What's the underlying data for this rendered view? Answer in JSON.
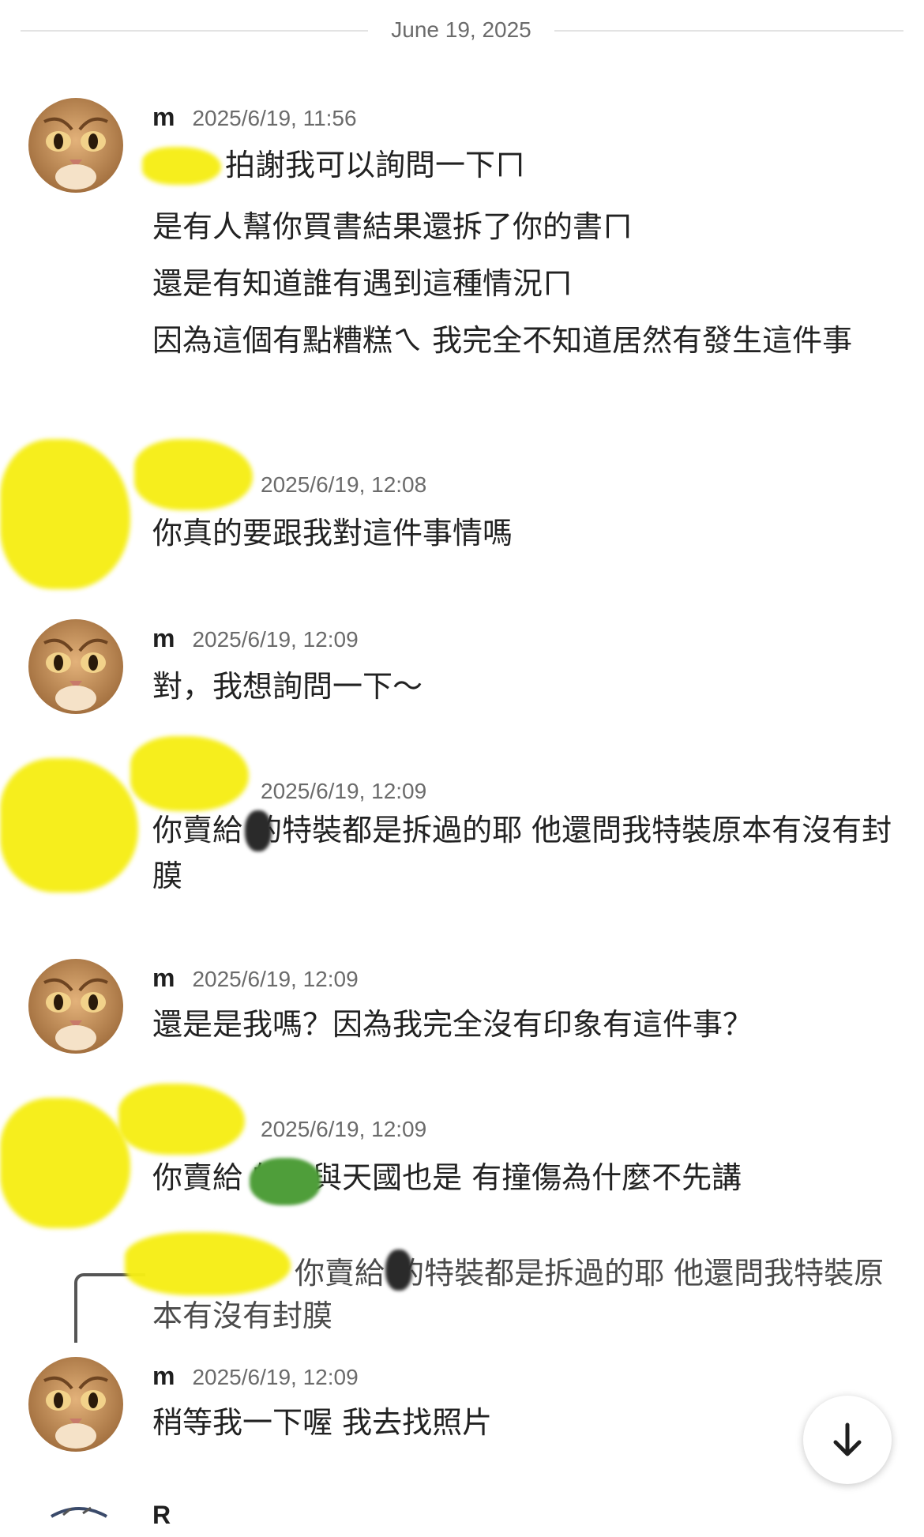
{
  "date_divider": "June 19, 2025",
  "messages": [
    {
      "sender": "m",
      "time": "2025/6/19, 11:56",
      "lines": [
        "拍謝我可以詢問一下ㄇ",
        "是有人幫你買書結果還拆了你的書ㄇ",
        "還是有知道誰有遇到這種情況ㄇ",
        "因為這個有點糟糕ㄟ 我完全不知道居然有發生這件事"
      ]
    },
    {
      "sender": "",
      "time": "2025/6/19, 12:08",
      "lines": [
        "你真的要跟我對這件事情嗎"
      ]
    },
    {
      "sender": "m",
      "time": "2025/6/19, 12:09",
      "lines": [
        "對，我想詢問一下～"
      ]
    },
    {
      "sender": "",
      "time": "2025/6/19, 12:09",
      "lines": [
        "你賣給 的特裝都是拆過的耶  他還問我特裝原本有沒有封膜"
      ]
    },
    {
      "sender": "m",
      "time": "2025/6/19, 12:09",
      "lines": [
        "還是是我嗎？因為我完全沒有印象有這件事？"
      ]
    },
    {
      "sender": "",
      "time": "2025/6/19, 12:09",
      "lines": [
        "你賣給       的鬼與天國也是  有撞傷為什麼不先講"
      ]
    },
    {
      "reply_quote": "你賣給 的特裝都是拆過的耶  他還問我特裝原本有沒有封膜",
      "sender": "m",
      "time": "2025/6/19, 12:09",
      "lines": [
        "稍等我一下喔 我去找照片"
      ]
    }
  ],
  "next_sender_partial": "R",
  "icons": {
    "scroll_down": "arrow-down-icon",
    "avatar": "cat-avatar"
  },
  "colors": {
    "redaction_yellow": "#f6ee16",
    "redaction_green": "#4f9e3a",
    "muted_text": "#6b6b6b"
  }
}
